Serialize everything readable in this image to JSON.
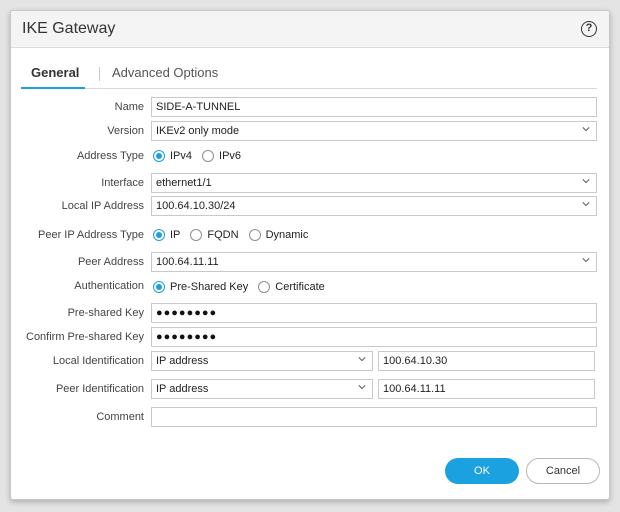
{
  "dialog": {
    "title": "IKE Gateway"
  },
  "tabs": {
    "general": "General",
    "advanced": "Advanced Options"
  },
  "form": {
    "name": {
      "label": "Name",
      "value": "SIDE-A-TUNNEL"
    },
    "version": {
      "label": "Version",
      "value": "IKEv2 only mode"
    },
    "address_type": {
      "label": "Address Type",
      "options": [
        "IPv4",
        "IPv6"
      ],
      "selected": "IPv4"
    },
    "interface": {
      "label": "Interface",
      "value": "ethernet1/1"
    },
    "local_ip": {
      "label": "Local IP Address",
      "value": "100.64.10.30/24"
    },
    "peer_ip_type": {
      "label": "Peer IP Address Type",
      "options": [
        "IP",
        "FQDN",
        "Dynamic"
      ],
      "selected": "IP"
    },
    "peer_address": {
      "label": "Peer Address",
      "value": "100.64.11.11"
    },
    "authentication": {
      "label": "Authentication",
      "options": [
        "Pre-Shared Key",
        "Certificate"
      ],
      "selected": "Pre-Shared Key"
    },
    "psk": {
      "label": "Pre-shared Key",
      "value": "●●●●●●●●"
    },
    "confirm_psk": {
      "label": "Confirm Pre-shared Key",
      "value": "●●●●●●●●"
    },
    "local_id": {
      "label": "Local Identification",
      "type": "IP address",
      "value": "100.64.10.30"
    },
    "peer_id": {
      "label": "Peer Identification",
      "type": "IP address",
      "value": "100.64.11.11"
    },
    "comment": {
      "label": "Comment",
      "value": ""
    }
  },
  "buttons": {
    "ok": "OK",
    "cancel": "Cancel"
  },
  "colors": {
    "accent": "#1ba0e0"
  },
  "icons": {
    "help": "help-icon",
    "dropdown": "chevron-down-icon"
  }
}
